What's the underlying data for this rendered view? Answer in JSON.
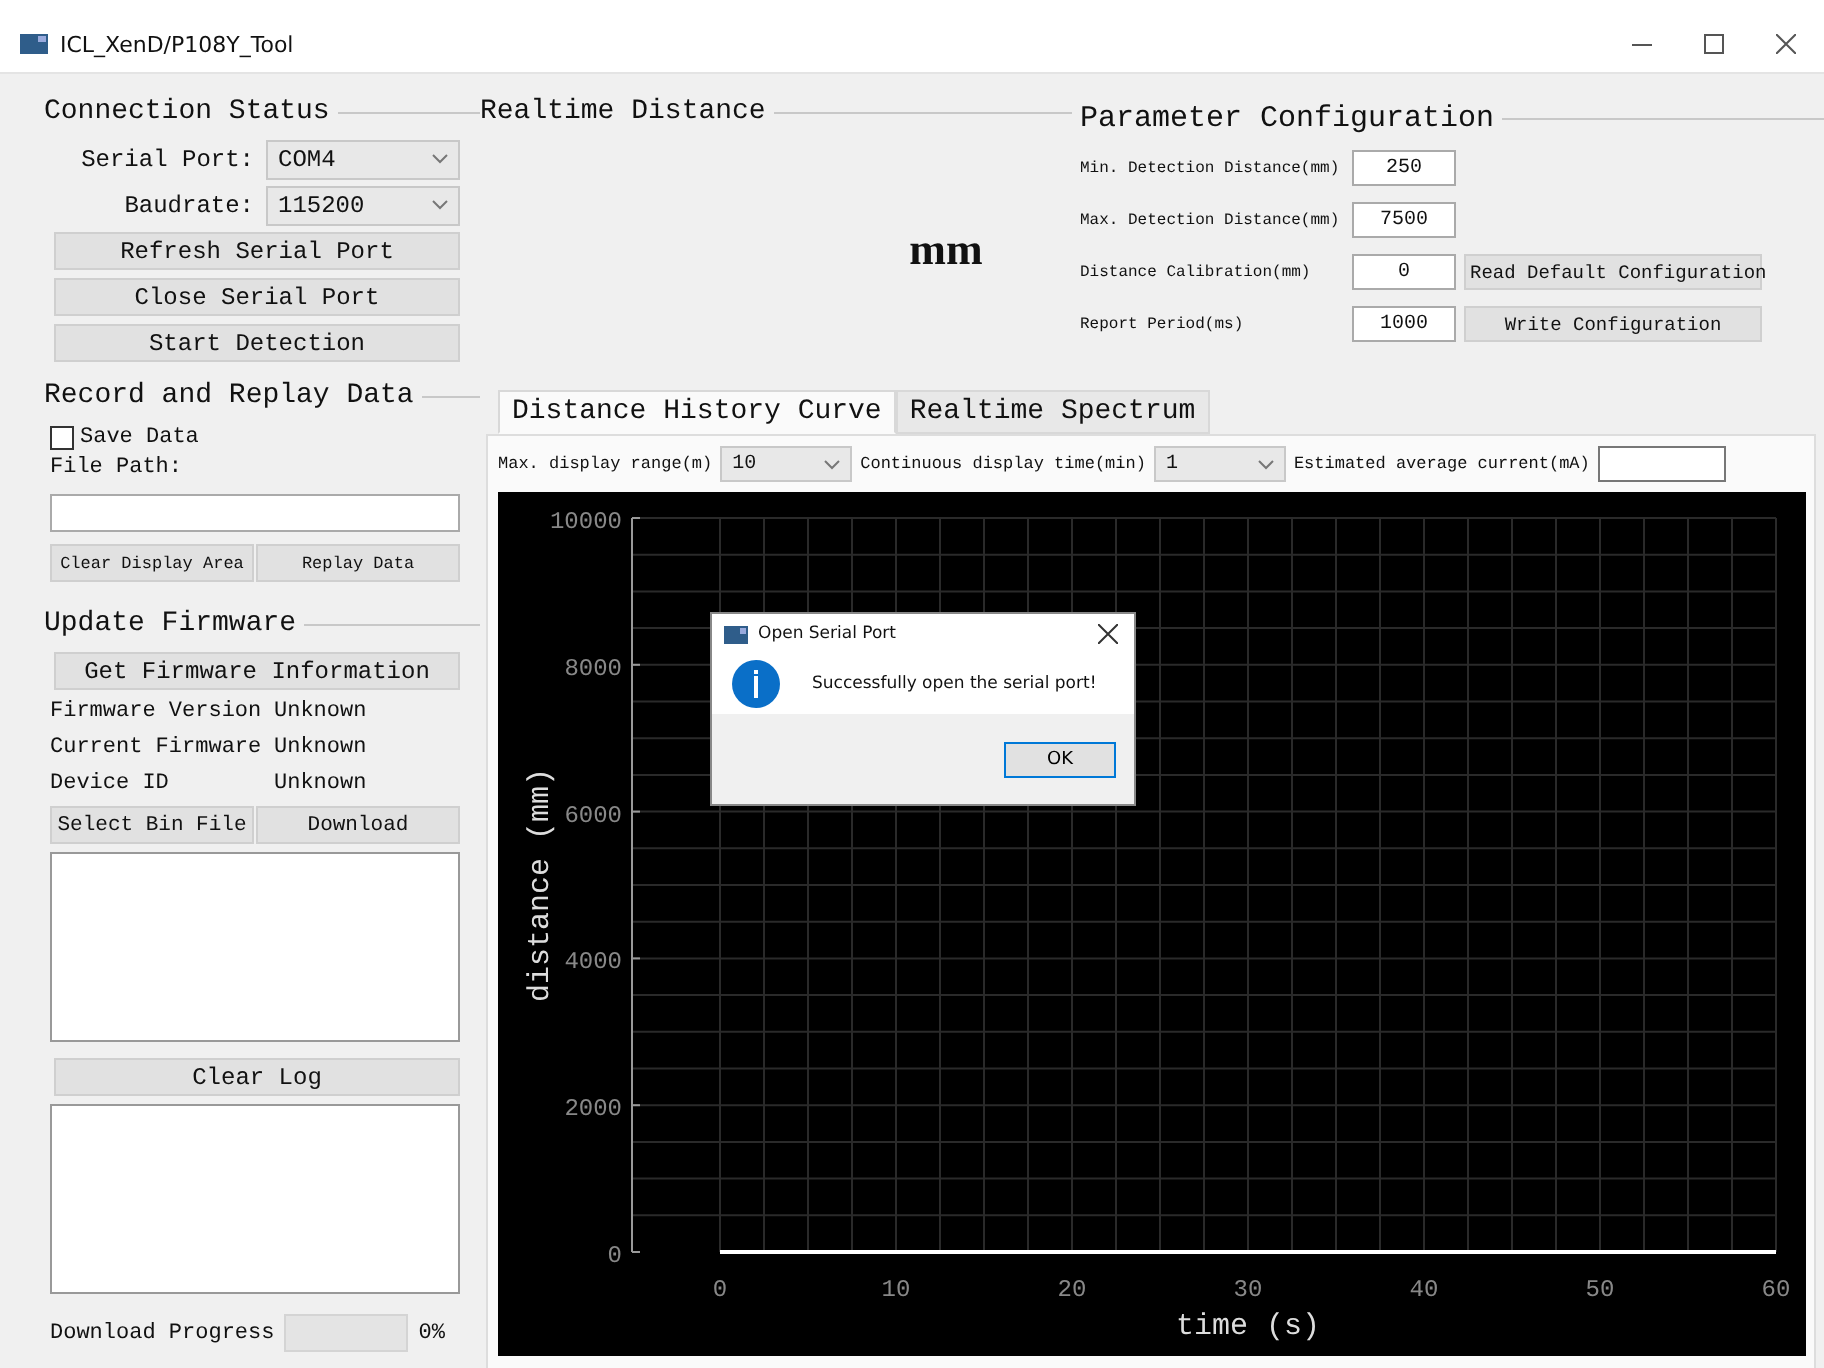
{
  "window": {
    "title": "ICL_XenD/P108Y_Tool"
  },
  "connection_status": {
    "title": "Connection Status",
    "fields": [
      {
        "label": "Serial Port:",
        "value": "COM4"
      },
      {
        "label": "Baudrate:",
        "value": "115200"
      }
    ],
    "buttons": [
      "Refresh Serial Port",
      "Close Serial Port",
      "Start Detection"
    ]
  },
  "record_replay": {
    "title": "Record and Replay Data",
    "save_data": {
      "label": "Save Data",
      "checked": false
    },
    "file_path_label": "File Path:",
    "buttons": [
      "Clear Display Area",
      "Replay Data"
    ]
  },
  "update_firmware": {
    "title": "Update Firmware",
    "info_button": "Get Firmware Information",
    "info": [
      {
        "label": "Firmware Version",
        "value": "Unknown"
      },
      {
        "label": "Current Firmware",
        "value": "Unknown"
      },
      {
        "label": "Device ID",
        "value": "Unknown"
      }
    ],
    "buttons": [
      "Select Bin File",
      "Download"
    ],
    "clear_log": "Clear Log",
    "progress": {
      "label": "Download Progress",
      "level": 0,
      "reading": "0%"
    }
  },
  "realtime_distance": {
    "title": "Realtime Distance",
    "unit": "mm"
  },
  "parameter_configuration": {
    "title": "Parameter Configuration",
    "rows": [
      {
        "label": "Min. Detection Distance(mm)",
        "value": "250"
      },
      {
        "label": "Max. Detection Distance(mm)",
        "value": "7500"
      },
      {
        "label": "Distance Calibration(mm)",
        "value": "0",
        "button": "Read Default Configuration"
      },
      {
        "label": "Report Period(ms)",
        "value": "1000",
        "button": "Write Configuration"
      }
    ]
  },
  "tabs": [
    {
      "label": "Distance History Curve",
      "selected": true
    },
    {
      "label": "Realtime Spectrum",
      "selected": false
    }
  ],
  "history": {
    "controls": [
      {
        "kind": "select",
        "label": "Max. display range(m)",
        "value": "10"
      },
      {
        "kind": "select",
        "label": "Continuous display time(min)",
        "value": "1"
      },
      {
        "kind": "input",
        "label": "Estimated average current(mA)"
      }
    ],
    "chart_data": {
      "type": "line",
      "xlabel": "time (s)",
      "ylabel": "distance (mm)",
      "x": [
        0,
        60
      ],
      "series": [
        {
          "color": "#ffffff",
          "values": [
            0,
            0
          ]
        }
      ],
      "grid": true,
      "xlim": [
        -5,
        60
      ],
      "ylim": [
        0,
        10000
      ],
      "xticks": [
        0,
        10,
        20,
        30,
        40,
        50,
        60
      ],
      "yticks": [
        0,
        2000,
        4000,
        6000,
        8000,
        10000
      ]
    }
  },
  "dialog": {
    "title": "Open Serial Port",
    "message": "Successfully open the serial port!",
    "button": "OK"
  }
}
